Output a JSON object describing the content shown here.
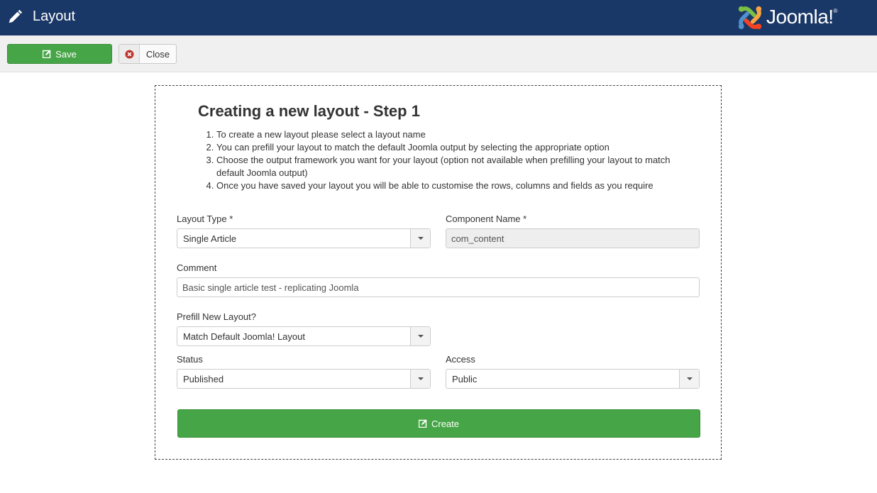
{
  "header": {
    "page_icon": "pencil-icon",
    "title": "Layout",
    "logo_text": "Joomla!",
    "logo_registered": "®"
  },
  "toolbar": {
    "save_label": "Save",
    "save_icon": "edit-icon",
    "close_label": "Close",
    "close_icon": "close-circle-icon"
  },
  "form": {
    "heading": "Creating a new layout - Step 1",
    "instructions": [
      "To create a new layout please select a layout name",
      "You can prefill your layout to match the default Joomla output by selecting the appropriate option",
      "Choose the output framework you want for your layout (option not available when prefilling your layout to match default Joomla output)",
      "Once you have saved your layout you will be able to customise the rows, columns and fields as you require"
    ],
    "layout_type": {
      "label": "Layout Type *",
      "value": "Single Article"
    },
    "component_name": {
      "label": "Component Name *",
      "value": "com_content"
    },
    "comment": {
      "label": "Comment",
      "value": "Basic single article test - replicating Joomla"
    },
    "prefill": {
      "label": "Prefill New Layout?",
      "value": "Match Default Joomla! Layout"
    },
    "status": {
      "label": "Status",
      "value": "Published"
    },
    "access": {
      "label": "Access",
      "value": "Public"
    },
    "create_label": "Create",
    "create_icon": "edit-icon"
  },
  "colors": {
    "header_bg": "#1a3867",
    "success": "#46a546",
    "toolbar_bg": "#f0f0f0"
  }
}
